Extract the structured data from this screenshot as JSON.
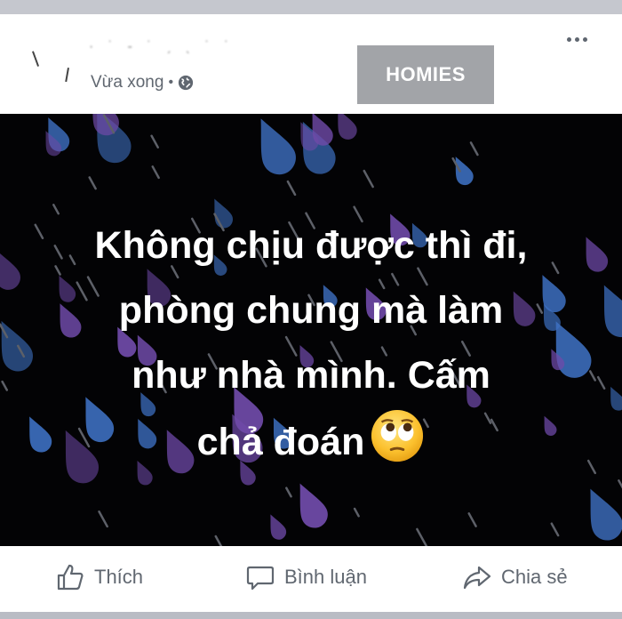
{
  "post": {
    "author_name": "· ˙ - ˙ ˏ ˎ ˙ ˙",
    "timestamp": "Vừa xong",
    "separator": "•",
    "privacy_icon": "globe-icon",
    "watermark_label": "HOMIES",
    "more_icon": "more-horizontal-icon",
    "text_lines": [
      "Không chịu được thì đi,",
      "phòng chung mà làm",
      "như nhà mình. Cấm",
      "chả đoán"
    ],
    "emoji": "face-with-rolling-eyes-emoji",
    "background_colors": {
      "base": "#030305",
      "drop_purple": "#6f4aa8",
      "drop_blue": "#3d6fc0"
    }
  },
  "actions": {
    "like_label": "Thích",
    "comment_label": "Bình luận",
    "share_label": "Chia sẻ"
  },
  "colors": {
    "meta_text": "#606770",
    "badge_bg": "#a2a4a8"
  }
}
